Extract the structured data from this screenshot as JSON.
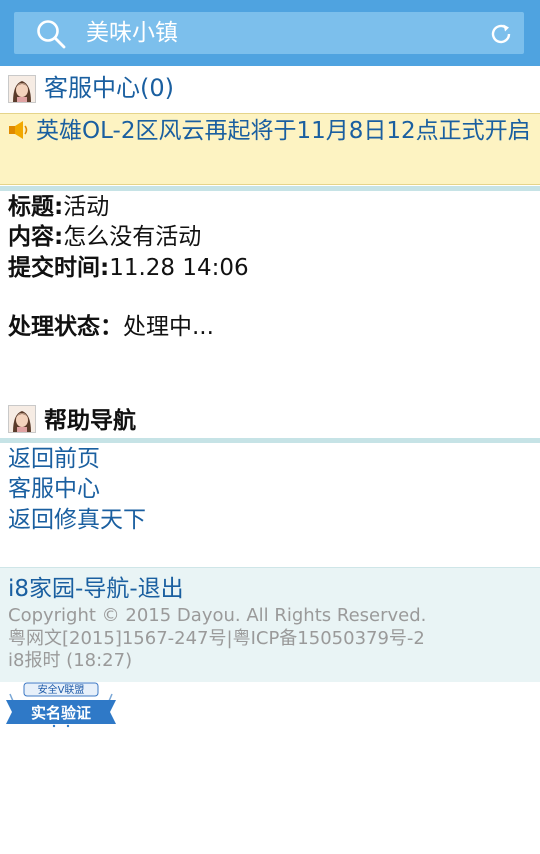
{
  "search": {
    "text": "美味小镇"
  },
  "customer_service": {
    "label": "客服中心(0)"
  },
  "notice": {
    "text": "英雄OL-2区风云再起将于11月8日12点正式开启"
  },
  "ticket": {
    "title_label": "标题:",
    "title_value": "活动",
    "content_label": "内容:",
    "content_value": "怎么没有活动",
    "time_label": "提交时间:",
    "time_value": "11.28 14:06",
    "status_label": "处理状态：",
    "status_value": "处理中..."
  },
  "help": {
    "title": "帮助导航",
    "links": [
      "返回前页",
      "客服中心",
      "返回修真天下"
    ]
  },
  "footer": {
    "nav": [
      "i8家园",
      "导航",
      "退出"
    ],
    "separator": "-",
    "copyright": "Copyright © 2015 Dayou. All Rights Reserved.",
    "license": "粤网文[2015]1567-247号|粤ICP备15050379号-2",
    "time": "i8报时 (18:27)"
  },
  "badge": {
    "top_text": "安全V联盟",
    "main_text": "实名验证"
  },
  "colors": {
    "topbar": "#4fa3e0",
    "searchbox": "#7cbfec",
    "link": "#1a5fa0",
    "notice_bg": "#fdf3c2",
    "divider": "#c6e3e6",
    "footer_bg": "#e9f4f5"
  }
}
